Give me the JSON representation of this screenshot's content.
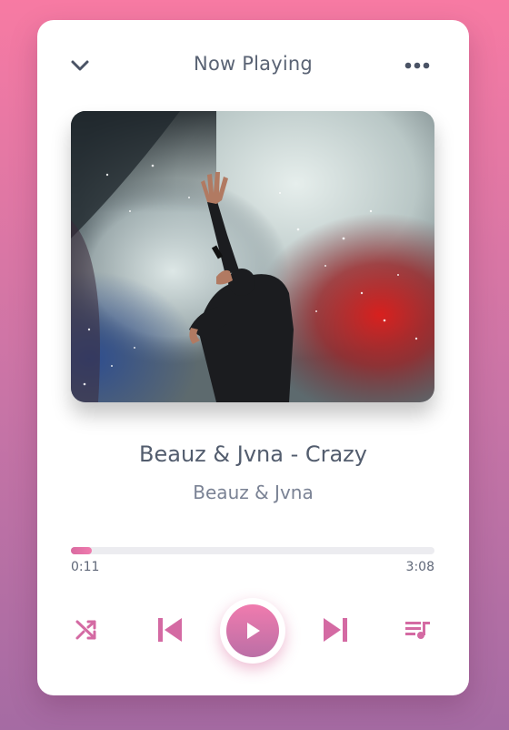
{
  "header": {
    "title": "Now Playing",
    "collapse_icon": "chevron-down-icon",
    "more_icon": "more-horizontal-icon"
  },
  "track": {
    "title": "Beauz & Jvna - Crazy",
    "artist": "Beauz & Jvna",
    "cover_description": "concert singer with raised hand in smoke and lights"
  },
  "progress": {
    "current_time": "0:11",
    "total_time": "3:08",
    "fraction": 0.058
  },
  "controls": {
    "shuffle_icon": "shuffle-icon",
    "previous_icon": "skip-previous-icon",
    "play_icon": "play-icon",
    "next_icon": "skip-next-icon",
    "queue_icon": "queue-music-icon"
  },
  "colors": {
    "accent": "#e06fa6",
    "text_primary": "#535d6e",
    "text_secondary": "#7a8294",
    "track_bg": "#ececf0"
  }
}
